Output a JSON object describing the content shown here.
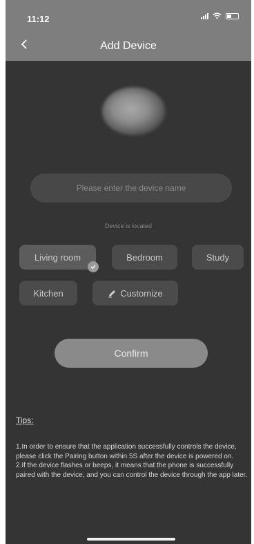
{
  "status_bar": {
    "time": "11:12"
  },
  "header": {
    "title": "Add Device"
  },
  "device_name_input": {
    "placeholder": "Please enter the device name",
    "value": ""
  },
  "location": {
    "label": "Device is located",
    "options": [
      "Living room",
      "Bedroom",
      "Study",
      "Kitchen",
      "Customize"
    ],
    "selected": "Living room"
  },
  "confirm_label": "Confirm",
  "tips": {
    "title": "Tips:",
    "lines": [
      "1.In order to ensure that the application successfully controls the device, please click the Pairing button within 5S after the device is powered on.",
      "2.If the device flashes or beeps, it means that the phone is successfully paired with the device, and you can control the device through the app later."
    ]
  },
  "colors": {
    "header_bg": "#7e7e7e",
    "page_bg": "#343434",
    "chip_bg": "#4b4b4b",
    "confirm_bg": "#8a8a8a"
  }
}
